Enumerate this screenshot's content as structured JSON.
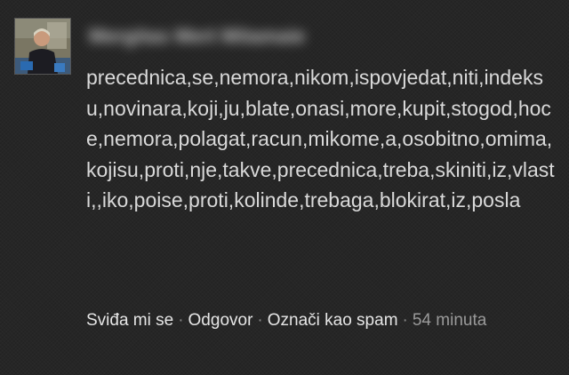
{
  "comment": {
    "author_name": "Mergitas Mert Mitamaie",
    "avatar_icon": "user-photo",
    "text": "precednica,se,nemora,nikom,ispovjedat,niti,indeksu,novinara,koji,ju,blate,onasi,more,kupit,stogod,hoce,nemora,polagat,racun,mikome,a,osobitno,omima,kojisu,proti,nje,takve,precednica,treba,skiniti,iz,vlasti,,iko,poise,proti,kolinde,trebaga,blokirat,iz,posla",
    "actions": {
      "like_label": "Sviđa mi se",
      "reply_label": "Odgovor",
      "spam_label": "Označi kao spam",
      "separator": "·",
      "timestamp": "54 minuta"
    }
  },
  "colors": {
    "background": "#262626",
    "text": "#d9d9d9",
    "link": "#e6e6e6",
    "muted": "#9a9a9a"
  }
}
